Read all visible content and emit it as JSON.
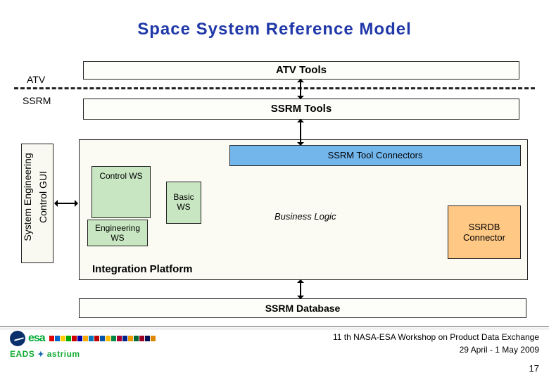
{
  "title": "Space System Reference Model",
  "atv_label": "ATV",
  "atv_tools": "ATV Tools",
  "ssrm_label": "SSRM",
  "ssrm_tools": "SSRM Tools",
  "se_gui_line1": "System Engineering",
  "se_gui_line2": "Control GUI",
  "connectors": "SSRM Tool Connectors",
  "control_ws": "Control WS",
  "basic_ws_l1": "Basic",
  "basic_ws_l2": "WS",
  "eng_ws_l1": "Engineering",
  "eng_ws_l2": "WS",
  "biz_logic": "Business Logic",
  "ssrdb_l1": "SSRDB",
  "ssrdb_l2": "Connector",
  "integration": "Integration Platform",
  "ssrm_db": "SSRM Database",
  "footer": {
    "workshop": "11 th NASA-ESA Workshop on Product Data Exchange",
    "dates": "29 April - 1 May 2009",
    "page": "17",
    "esa_text": "esa"
  },
  "flag_colors": [
    "#d00",
    "#06c",
    "#fc0",
    "#0a0",
    "#c00",
    "#00a",
    "#fa0",
    "#07b",
    "#b00",
    "#05a",
    "#fb0",
    "#084",
    "#a03",
    "#028",
    "#e90",
    "#063",
    "#902",
    "#015",
    "#d80"
  ]
}
